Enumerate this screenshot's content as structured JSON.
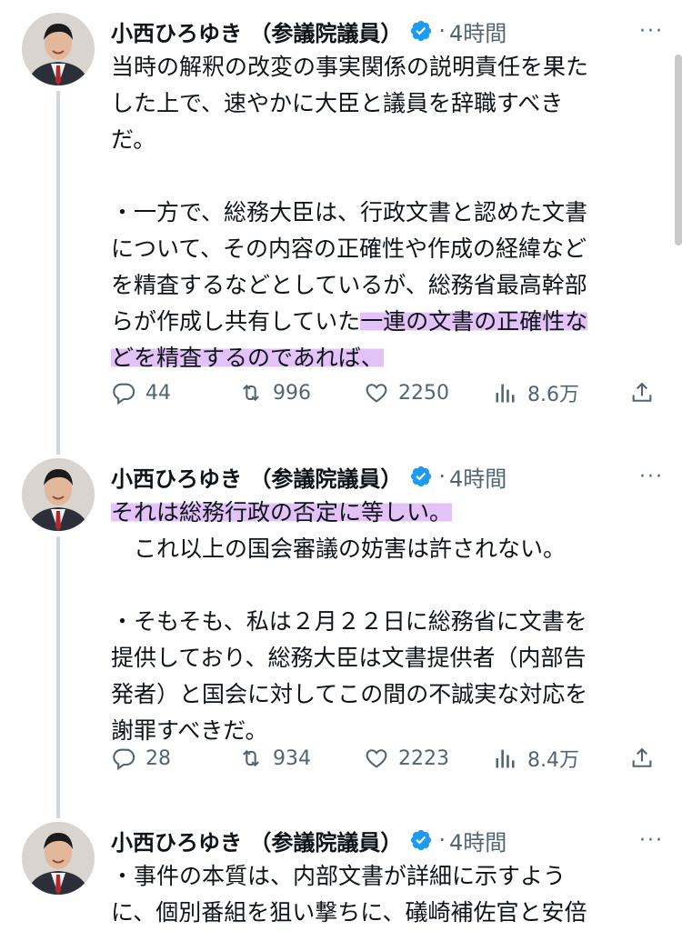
{
  "tweets": [
    {
      "author_name": "小西ひろゆき （参議院議員）",
      "dot": "·",
      "time": "4時間",
      "more": "···",
      "lines": [
        {
          "text": "当時の解釈の改変の事実関係の説明責任を果た"
        },
        {
          "text": "した上で、速やかに大臣と議員を辞職すべき"
        },
        {
          "text": "だ。"
        },
        {
          "text": ""
        },
        {
          "text": "・一方で、総務大臣は、行政文書と認めた文書"
        },
        {
          "text": "について、その内容の正確性や作成の経緯など"
        },
        {
          "text": "を精査するなどとしているが、総務省最高幹部"
        },
        {
          "text": "らが作成し共有していた",
          "hl": "一連の文書の正確性な"
        },
        {
          "text": "",
          "hl": "どを精査するのであれば、"
        }
      ],
      "stats": {
        "replies": "44",
        "retweets": "996",
        "likes": "2250",
        "views": "8.6万"
      }
    },
    {
      "author_name": "小西ひろゆき （参議院議員）",
      "dot": "·",
      "time": "4時間",
      "more": "···",
      "lines": [
        {
          "text": "",
          "hl": "それは総務行政の否定に等しい。"
        },
        {
          "text": "　これ以上の国会審議の妨害は許されない。"
        },
        {
          "text": ""
        },
        {
          "text": "・そもそも、私は２月２２日に総務省に文書を"
        },
        {
          "text": "提供しており、総務大臣は文書提供者（内部告"
        },
        {
          "text": "発者）と国会に対してこの間の不誠実な対応を"
        },
        {
          "text": "謝罪すべきだ。"
        }
      ],
      "stats": {
        "replies": "28",
        "retweets": "934",
        "likes": "2223",
        "views": "8.4万"
      }
    },
    {
      "author_name": "小西ひろゆき （参議院議員）",
      "dot": "·",
      "time": "4時間",
      "more": "···",
      "lines": [
        {
          "text": "・事件の本質は、内部文書が詳細に示すよう"
        },
        {
          "text": "に、個別番組を狙い撃ちに、礒崎補佐官と安倍"
        }
      ]
    }
  ],
  "colors": {
    "text": "#0f1419",
    "secondary": "#536471",
    "verified": "#1d9bf0",
    "highlight": "#e3c3f7",
    "thread_line": "#cfd9de"
  },
  "icons": [
    "reply-icon",
    "retweet-icon",
    "like-icon",
    "views-icon",
    "share-icon",
    "verified-badge-icon",
    "more-icon"
  ]
}
